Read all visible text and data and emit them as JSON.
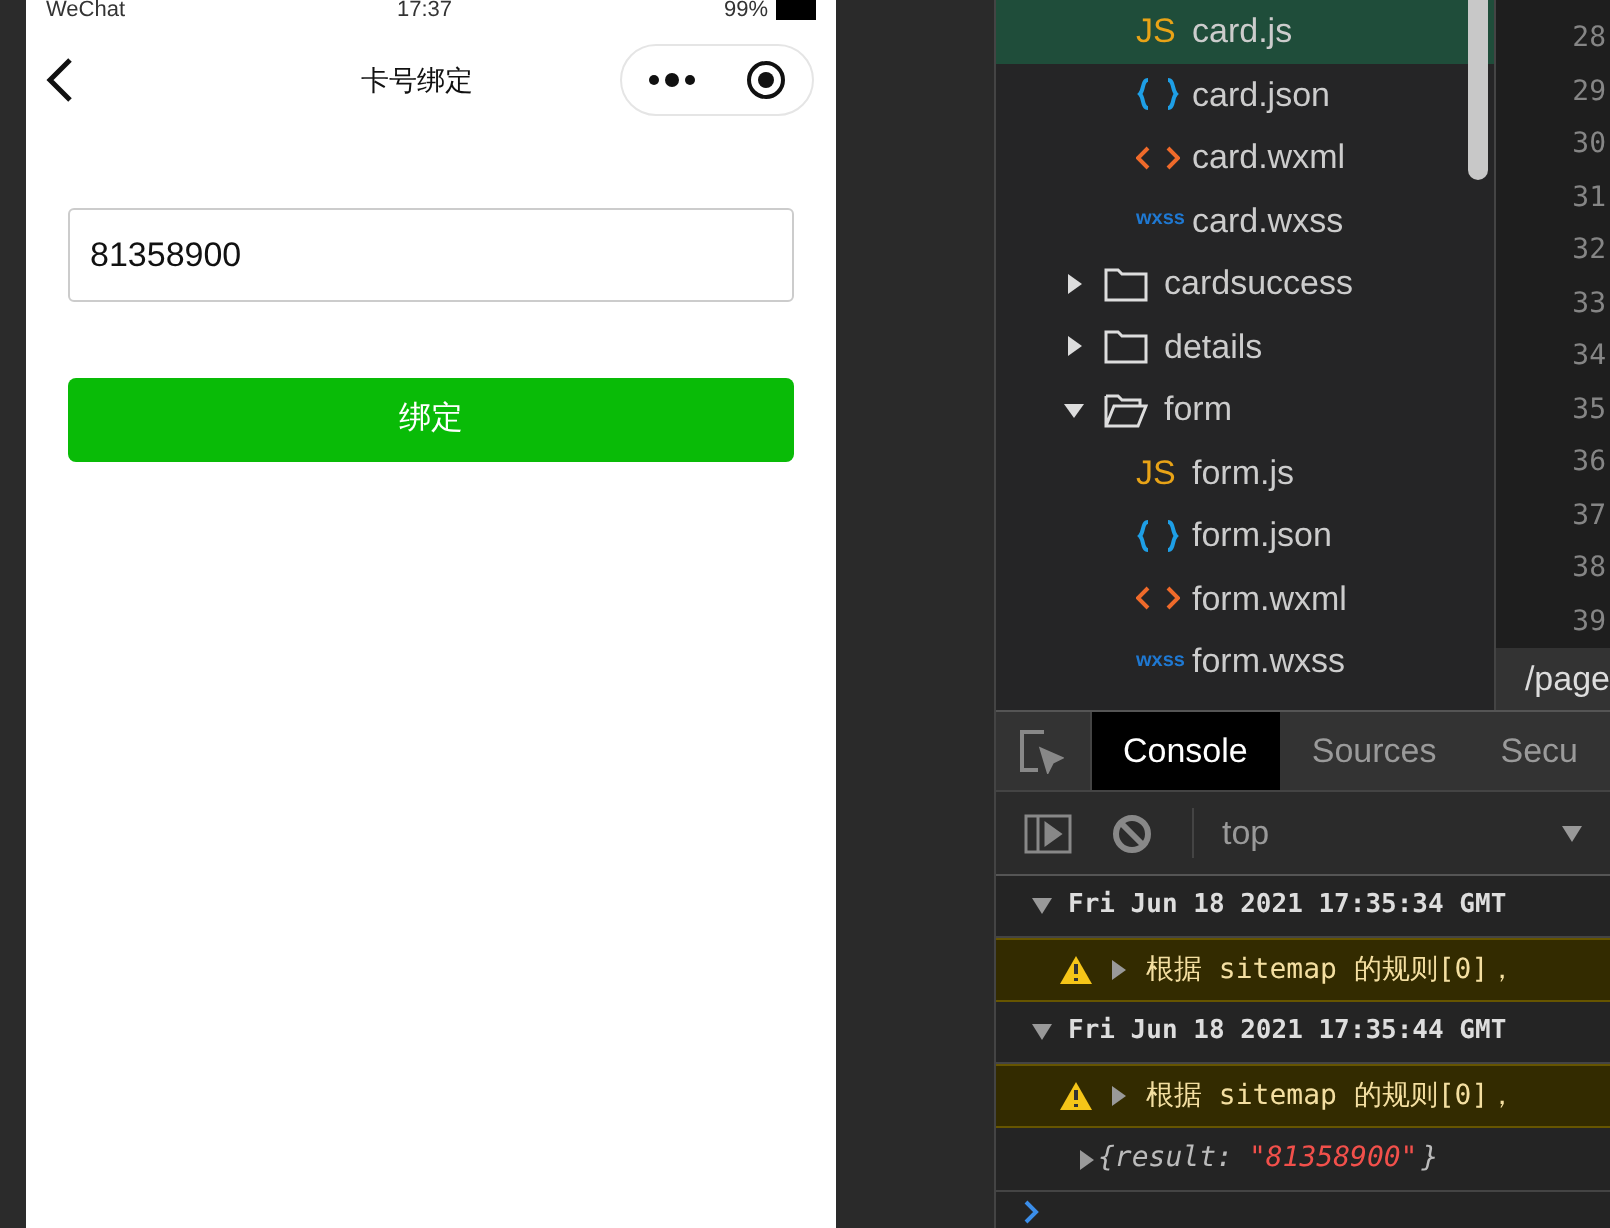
{
  "phone": {
    "status_bar": {
      "carrier": "WeChat",
      "time": "17:37",
      "battery": "99%"
    },
    "nav": {
      "title": "卡号绑定"
    },
    "card_field": {
      "value": "81358900"
    },
    "bind_button": {
      "label": "绑定"
    }
  },
  "file_tree": [
    {
      "children": [
        {
          "kind": "js",
          "icon_text": "JS",
          "label": "card.js",
          "selected": true
        },
        {
          "kind": "json",
          "label": "card.json",
          "selected": false
        },
        {
          "kind": "wxml",
          "label": "card.wxml",
          "selected": false
        },
        {
          "kind": "wxss",
          "icon_text": "wxss",
          "label": "card.wxss",
          "selected": false
        }
      ]
    },
    {
      "kind": "folder",
      "label": "cardsuccess",
      "expanded": false,
      "selected": false
    },
    {
      "kind": "folder",
      "label": "details",
      "expanded": false,
      "selected": false
    },
    {
      "kind": "folder",
      "label": "form",
      "expanded": true,
      "selected": false,
      "children": [
        {
          "kind": "js",
          "icon_text": "JS",
          "label": "form.js",
          "selected": false
        },
        {
          "kind": "json",
          "label": "form.json",
          "selected": false
        },
        {
          "kind": "wxml",
          "label": "form.wxml",
          "selected": false
        },
        {
          "kind": "wxss",
          "icon_text": "wxss",
          "label": "form.wxss",
          "selected": false
        }
      ]
    }
  ],
  "editor": {
    "line_numbers": [
      "28",
      "29",
      "30",
      "31",
      "32",
      "33",
      "34",
      "35",
      "36",
      "37",
      "38",
      "39"
    ],
    "tab": "/page"
  },
  "devtools": {
    "tabs": [
      {
        "label": "Console",
        "selected": true
      },
      {
        "label": "Sources",
        "selected": false
      },
      {
        "label": "Secu",
        "selected": false
      }
    ],
    "context": "top",
    "log": [
      {
        "kind": "group",
        "text": "Fri Jun 18 2021 17:35:34 GMT"
      },
      {
        "kind": "warning",
        "text": "根据 sitemap 的规则[0]，"
      },
      {
        "kind": "group",
        "text": "Fri Jun 18 2021 17:35:44 GMT"
      },
      {
        "kind": "warning",
        "text": "根据 sitemap 的规则[0]，"
      },
      {
        "kind": "object",
        "key": "{result:",
        "value": "\"81358900\"",
        "close": "}"
      }
    ]
  }
}
